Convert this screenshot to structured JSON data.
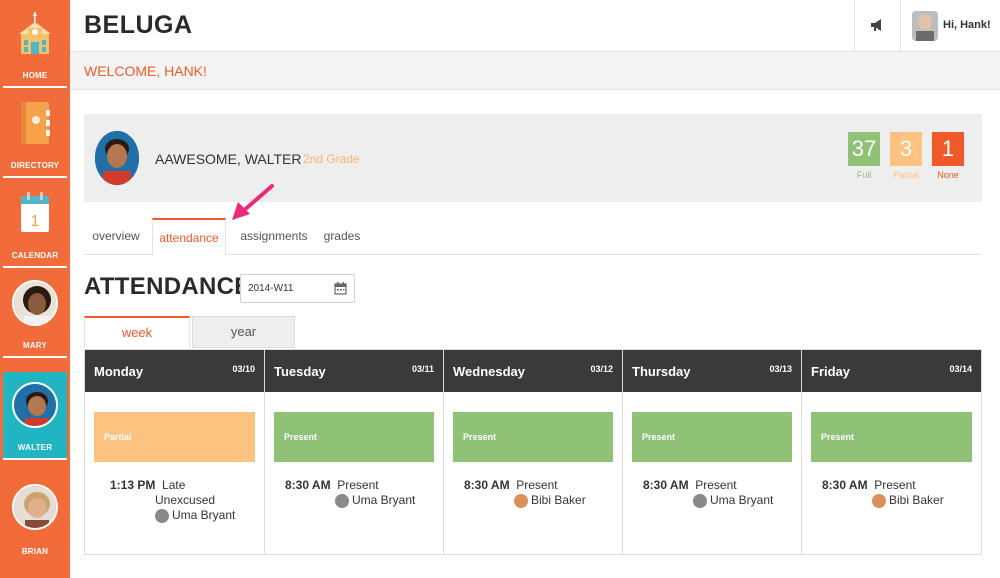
{
  "app": {
    "title": "BELUGA"
  },
  "sidebar": {
    "items": [
      {
        "label": "HOME",
        "icon": "school-icon"
      },
      {
        "label": "DIRECTORY",
        "icon": "directory-book-icon"
      },
      {
        "label": "CALENDAR",
        "icon": "calendar-icon",
        "calendar_day": "1"
      },
      {
        "label": "MARY",
        "icon": "avatar"
      },
      {
        "label": "WALTER",
        "icon": "avatar",
        "active": true
      },
      {
        "label": "BRIAN",
        "icon": "avatar"
      }
    ]
  },
  "header": {
    "greeting": "Hi, Hank!",
    "welcome": "WELCOME, HANK!",
    "notification_icon": "megaphone-icon"
  },
  "student": {
    "name": "AAWESOME, WALTER",
    "grade": "2nd Grade",
    "stats": [
      {
        "value": "37",
        "label": "Full",
        "color": "#8fc176"
      },
      {
        "value": "3",
        "label": "Partial",
        "color": "#fcc380"
      },
      {
        "value": "1",
        "label": "None",
        "color": "#f05a2a"
      }
    ]
  },
  "tabs": [
    {
      "label": "overview"
    },
    {
      "label": "attendance",
      "active": true
    },
    {
      "label": "assignments"
    },
    {
      "label": "grades"
    }
  ],
  "attendance": {
    "title": "ATTENDANCE",
    "week_value": "2014-W11",
    "views": [
      {
        "label": "week",
        "active": true
      },
      {
        "label": "year"
      }
    ],
    "days": [
      {
        "day": "Monday",
        "date": "03/10",
        "status": "Partial",
        "status_color": "#fcc380",
        "time": "1:13 PM",
        "note_lines": [
          "Late",
          "Unexcused"
        ],
        "teacher": "Uma Bryant"
      },
      {
        "day": "Tuesday",
        "date": "03/11",
        "status": "Present",
        "status_color": "#8fc176",
        "time": "8:30 AM",
        "note_lines": [
          "Present"
        ],
        "teacher": "Uma Bryant"
      },
      {
        "day": "Wednesday",
        "date": "03/12",
        "status": "Present",
        "status_color": "#8fc176",
        "time": "8:30 AM",
        "note_lines": [
          "Present"
        ],
        "teacher": "Bibi Baker"
      },
      {
        "day": "Thursday",
        "date": "03/13",
        "status": "Present",
        "status_color": "#8fc176",
        "time": "8:30 AM",
        "note_lines": [
          "Present"
        ],
        "teacher": "Uma Bryant"
      },
      {
        "day": "Friday",
        "date": "03/14",
        "status": "Present",
        "status_color": "#8fc176",
        "time": "8:30 AM",
        "note_lines": [
          "Present"
        ],
        "teacher": "Bibi Baker"
      }
    ]
  },
  "colors": {
    "brand_orange": "#f05a2a",
    "sidebar_orange": "#f26b3a",
    "active_teal": "#21b5c1",
    "day_header": "#3a3a3a"
  }
}
